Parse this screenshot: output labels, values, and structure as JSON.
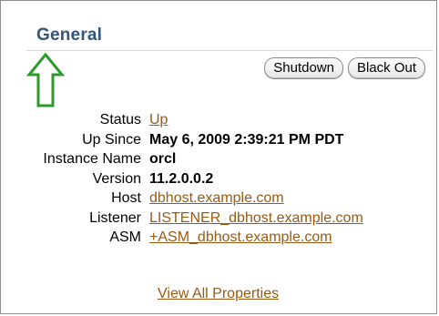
{
  "section": {
    "title": "General"
  },
  "toolbar": {
    "shutdown_label": "Shutdown",
    "blackout_label": "Black Out"
  },
  "properties": [
    {
      "label": "Status",
      "value": "Up",
      "kind": "link"
    },
    {
      "label": "Up Since",
      "value": "May 6, 2009 2:39:21 PM PDT",
      "kind": "bold"
    },
    {
      "label": "Instance Name",
      "value": "orcl",
      "kind": "bold"
    },
    {
      "label": "Version",
      "value": "11.2.0.0.2",
      "kind": "bold"
    },
    {
      "label": "Host",
      "value": "dbhost.example.com",
      "kind": "link"
    },
    {
      "label": "Listener",
      "value": "LISTENER_dbhost.example.com",
      "kind": "link"
    },
    {
      "label": "ASM",
      "value": "+ASM_dbhost.example.com",
      "kind": "link"
    }
  ],
  "view_all": {
    "label": "View All Properties"
  },
  "annotation": {
    "icon": "up-arrow-icon",
    "color": "#2e9a2e"
  },
  "colors": {
    "title": "#33557a",
    "link": "#9a5a14"
  }
}
